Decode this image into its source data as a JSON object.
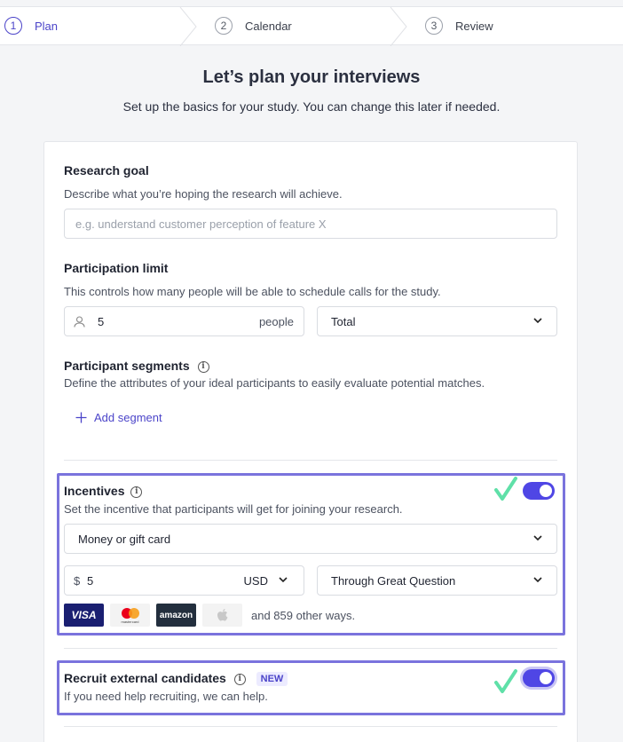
{
  "stepper": {
    "steps": [
      {
        "num": "1",
        "label": "Plan"
      },
      {
        "num": "2",
        "label": "Calendar"
      },
      {
        "num": "3",
        "label": "Review"
      }
    ]
  },
  "header": {
    "title": "Let’s plan your interviews",
    "subtitle": "Set up the basics for your study. You can change this later if needed."
  },
  "research_goal": {
    "label": "Research goal",
    "description": "Describe what you’re hoping the research will achieve.",
    "placeholder": "e.g. understand customer perception of feature X"
  },
  "participation_limit": {
    "label": "Participation limit",
    "description": "This controls how many people will be able to schedule calls for the study.",
    "value": "5",
    "unit": "people",
    "scope": "Total"
  },
  "segments": {
    "label": "Participant segments",
    "description": "Define the attributes of your ideal participants to easily evaluate potential matches.",
    "add_label": "Add segment"
  },
  "incentives": {
    "label": "Incentives",
    "description": "Set the incentive that participants will get for joining your research.",
    "type": "Money or gift card",
    "currency_symbol": "$",
    "amount": "5",
    "currency": "USD",
    "method": "Through Great Question",
    "payment_logos": [
      "VISA",
      "mastercard",
      "amazon",
      "apple"
    ],
    "other_ways": "and 859 other ways.",
    "enabled": true
  },
  "recruit": {
    "label": "Recruit external candidates",
    "badge": "NEW",
    "description": "If you need help recruiting, we can help.",
    "enabled": true
  },
  "colors": {
    "accent": "#4f46e5",
    "highlight": "#7a73dd",
    "check": "#5fe0a8"
  }
}
